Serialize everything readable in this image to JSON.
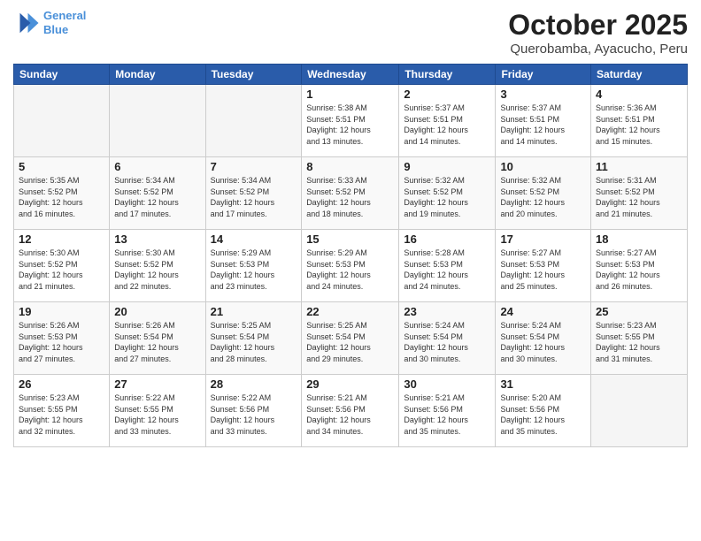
{
  "logo": {
    "line1": "General",
    "line2": "Blue"
  },
  "title": "October 2025",
  "subtitle": "Querobamba, Ayacucho, Peru",
  "weekdays": [
    "Sunday",
    "Monday",
    "Tuesday",
    "Wednesday",
    "Thursday",
    "Friday",
    "Saturday"
  ],
  "weeks": [
    [
      {
        "day": "",
        "info": ""
      },
      {
        "day": "",
        "info": ""
      },
      {
        "day": "",
        "info": ""
      },
      {
        "day": "1",
        "info": "Sunrise: 5:38 AM\nSunset: 5:51 PM\nDaylight: 12 hours\nand 13 minutes."
      },
      {
        "day": "2",
        "info": "Sunrise: 5:37 AM\nSunset: 5:51 PM\nDaylight: 12 hours\nand 14 minutes."
      },
      {
        "day": "3",
        "info": "Sunrise: 5:37 AM\nSunset: 5:51 PM\nDaylight: 12 hours\nand 14 minutes."
      },
      {
        "day": "4",
        "info": "Sunrise: 5:36 AM\nSunset: 5:51 PM\nDaylight: 12 hours\nand 15 minutes."
      }
    ],
    [
      {
        "day": "5",
        "info": "Sunrise: 5:35 AM\nSunset: 5:52 PM\nDaylight: 12 hours\nand 16 minutes."
      },
      {
        "day": "6",
        "info": "Sunrise: 5:34 AM\nSunset: 5:52 PM\nDaylight: 12 hours\nand 17 minutes."
      },
      {
        "day": "7",
        "info": "Sunrise: 5:34 AM\nSunset: 5:52 PM\nDaylight: 12 hours\nand 17 minutes."
      },
      {
        "day": "8",
        "info": "Sunrise: 5:33 AM\nSunset: 5:52 PM\nDaylight: 12 hours\nand 18 minutes."
      },
      {
        "day": "9",
        "info": "Sunrise: 5:32 AM\nSunset: 5:52 PM\nDaylight: 12 hours\nand 19 minutes."
      },
      {
        "day": "10",
        "info": "Sunrise: 5:32 AM\nSunset: 5:52 PM\nDaylight: 12 hours\nand 20 minutes."
      },
      {
        "day": "11",
        "info": "Sunrise: 5:31 AM\nSunset: 5:52 PM\nDaylight: 12 hours\nand 21 minutes."
      }
    ],
    [
      {
        "day": "12",
        "info": "Sunrise: 5:30 AM\nSunset: 5:52 PM\nDaylight: 12 hours\nand 21 minutes."
      },
      {
        "day": "13",
        "info": "Sunrise: 5:30 AM\nSunset: 5:52 PM\nDaylight: 12 hours\nand 22 minutes."
      },
      {
        "day": "14",
        "info": "Sunrise: 5:29 AM\nSunset: 5:53 PM\nDaylight: 12 hours\nand 23 minutes."
      },
      {
        "day": "15",
        "info": "Sunrise: 5:29 AM\nSunset: 5:53 PM\nDaylight: 12 hours\nand 24 minutes."
      },
      {
        "day": "16",
        "info": "Sunrise: 5:28 AM\nSunset: 5:53 PM\nDaylight: 12 hours\nand 24 minutes."
      },
      {
        "day": "17",
        "info": "Sunrise: 5:27 AM\nSunset: 5:53 PM\nDaylight: 12 hours\nand 25 minutes."
      },
      {
        "day": "18",
        "info": "Sunrise: 5:27 AM\nSunset: 5:53 PM\nDaylight: 12 hours\nand 26 minutes."
      }
    ],
    [
      {
        "day": "19",
        "info": "Sunrise: 5:26 AM\nSunset: 5:53 PM\nDaylight: 12 hours\nand 27 minutes."
      },
      {
        "day": "20",
        "info": "Sunrise: 5:26 AM\nSunset: 5:54 PM\nDaylight: 12 hours\nand 27 minutes."
      },
      {
        "day": "21",
        "info": "Sunrise: 5:25 AM\nSunset: 5:54 PM\nDaylight: 12 hours\nand 28 minutes."
      },
      {
        "day": "22",
        "info": "Sunrise: 5:25 AM\nSunset: 5:54 PM\nDaylight: 12 hours\nand 29 minutes."
      },
      {
        "day": "23",
        "info": "Sunrise: 5:24 AM\nSunset: 5:54 PM\nDaylight: 12 hours\nand 30 minutes."
      },
      {
        "day": "24",
        "info": "Sunrise: 5:24 AM\nSunset: 5:54 PM\nDaylight: 12 hours\nand 30 minutes."
      },
      {
        "day": "25",
        "info": "Sunrise: 5:23 AM\nSunset: 5:55 PM\nDaylight: 12 hours\nand 31 minutes."
      }
    ],
    [
      {
        "day": "26",
        "info": "Sunrise: 5:23 AM\nSunset: 5:55 PM\nDaylight: 12 hours\nand 32 minutes."
      },
      {
        "day": "27",
        "info": "Sunrise: 5:22 AM\nSunset: 5:55 PM\nDaylight: 12 hours\nand 33 minutes."
      },
      {
        "day": "28",
        "info": "Sunrise: 5:22 AM\nSunset: 5:56 PM\nDaylight: 12 hours\nand 33 minutes."
      },
      {
        "day": "29",
        "info": "Sunrise: 5:21 AM\nSunset: 5:56 PM\nDaylight: 12 hours\nand 34 minutes."
      },
      {
        "day": "30",
        "info": "Sunrise: 5:21 AM\nSunset: 5:56 PM\nDaylight: 12 hours\nand 35 minutes."
      },
      {
        "day": "31",
        "info": "Sunrise: 5:20 AM\nSunset: 5:56 PM\nDaylight: 12 hours\nand 35 minutes."
      },
      {
        "day": "",
        "info": ""
      }
    ]
  ]
}
